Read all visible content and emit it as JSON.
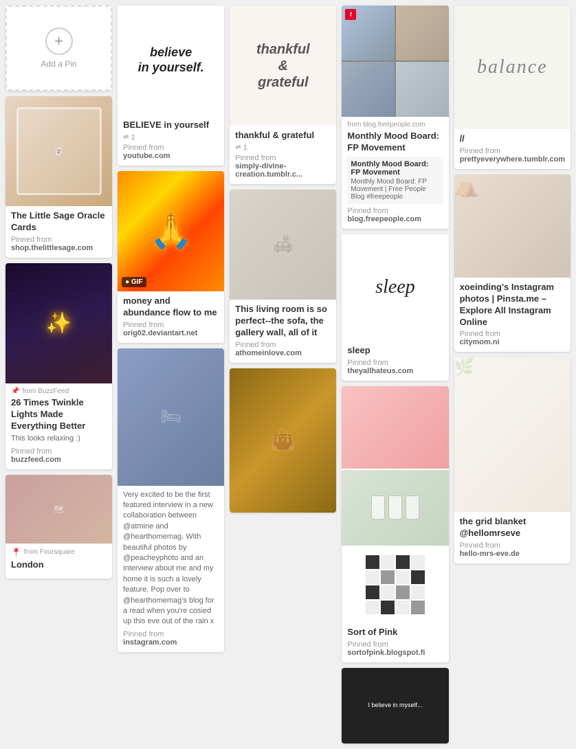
{
  "columns": [
    {
      "id": "col1",
      "cards": [
        {
          "id": "add-pin",
          "type": "add-pin",
          "label": "Add a Pin"
        },
        {
          "id": "oracle-cards",
          "type": "image-text",
          "title": "The Little Sage Oracle Cards",
          "pinned_from_label": "Pinned from",
          "pinned_from_url": "shop.thelittlesage.com",
          "img_type": "oracle"
        },
        {
          "id": "twinkle-lights",
          "type": "image-text",
          "from_label": "from BuzzFeed",
          "title": "26 Times Twinkle Lights Made Everything Better",
          "desc": "This looks relaxing :)",
          "pinned_from_label": "Pinned from",
          "pinned_from_url": "buzzfeed.com",
          "img_type": "twinkle"
        },
        {
          "id": "london",
          "type": "image-text",
          "from_label": "from Foursquare",
          "title": "London",
          "img_type": "london"
        }
      ]
    },
    {
      "id": "col2",
      "cards": [
        {
          "id": "believe",
          "type": "image-text",
          "title": "BELIEVE in yourself",
          "repins": "1",
          "pinned_from_label": "Pinned from",
          "pinned_from_url": "youtube.com",
          "img_type": "believe",
          "img_text": "believe\nin yourself."
        },
        {
          "id": "lakshmi",
          "type": "image-text",
          "title": "money and abundance flow to me",
          "is_gif": true,
          "pinned_from_label": "Pinned from",
          "pinned_from_url": "orig02.deviantart.net",
          "img_type": "lakshmi"
        },
        {
          "id": "bedroom",
          "type": "image-text",
          "title": "Very excited to be the first featured interview in a new collaboration between @atmine and @hearthomemag. With beautiful photos by @peacheyphoto and an interview about me and my home it is such a lovely feature. Pop over to @hearthomemag's blog for a read when you're cosied up this eve out of the rain x",
          "pinned_from_label": "Pinned from",
          "pinned_from_url": "instagram.com",
          "img_type": "bedroom"
        }
      ]
    },
    {
      "id": "col3",
      "cards": [
        {
          "id": "thankful",
          "type": "image-text",
          "title": "thankful & grateful",
          "repins": "1",
          "pinned_from_label": "Pinned from",
          "pinned_from_url": "simply-divine-creation.tumblr.c...",
          "img_type": "thankful",
          "img_text": "thankful\n&\ngrateful"
        },
        {
          "id": "livingroom",
          "type": "image-text",
          "title": "This living room is so perfect--the sofa, the gallery wall, all of it",
          "pinned_from_label": "Pinned from",
          "pinned_from_url": "athomeinlove.com",
          "img_type": "livingroom"
        },
        {
          "id": "wallet",
          "type": "image",
          "img_type": "wallet"
        }
      ]
    },
    {
      "id": "col4",
      "cards": [
        {
          "id": "moodboard",
          "type": "moodboard",
          "from_label": "from blog.freepeople.com",
          "title": "Monthly Mood Board: FP Movement",
          "overlay_title": "Monthly Mood Board: FP Movement",
          "overlay_desc": "Monthly Mood Board: FP Movement | Free People Blog #freepeople",
          "pinned_from_label": "Pinned from",
          "pinned_from_url": "blog.freepeople.com",
          "img_type": "moodboard"
        },
        {
          "id": "sleep",
          "type": "image-text",
          "title": "sleep",
          "pinned_from_label": "Pinned from",
          "pinned_from_url": "theyallhateus.com",
          "img_type": "sleep",
          "img_text": "sleep"
        },
        {
          "id": "sort-of-pink",
          "type": "composite",
          "title": "Sort of Pink",
          "pinned_from_label": "Pinned from",
          "pinned_from_url": "sortofpink.blogspot.fi"
        },
        {
          "id": "dark-quote",
          "type": "image",
          "img_type": "dark-quote"
        }
      ]
    },
    {
      "id": "col5",
      "cards": [
        {
          "id": "balance",
          "type": "image-text",
          "title": "//",
          "pinned_from_label": "Pinned from",
          "pinned_from_url": "prettyeverywhere.tumblr.com",
          "img_type": "balance",
          "img_text": "balance"
        },
        {
          "id": "instagram-photos",
          "type": "image-text",
          "title": "xoeinding's Instagram photos | Pinsta.me – Explore All Instagram Online",
          "pinned_from_label": "Pinned from",
          "pinned_from_url": "citymom.ni",
          "img_type": "teepee"
        },
        {
          "id": "grid-blanket",
          "type": "image-text",
          "title": "the grid blanket @hellomrseve",
          "pinned_from_label": "Pinned from",
          "pinned_from_url": "hello-mrs-eve.de",
          "img_type": "grid-blanket"
        }
      ]
    }
  ]
}
